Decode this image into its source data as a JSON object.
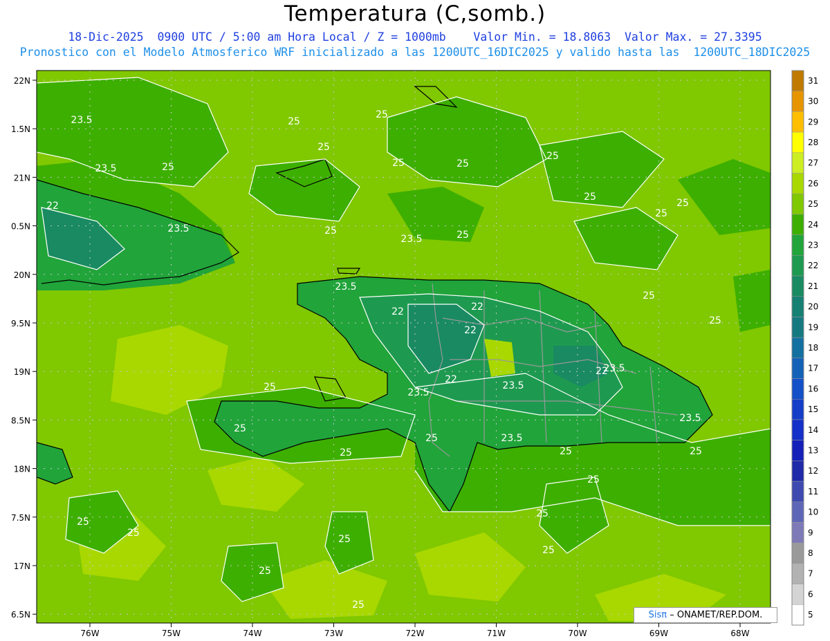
{
  "header": {
    "title": "Temperatura (C,somb.)",
    "line1": "18-Dic-2025  0900 UTC / 5:00 am Hora Local / Z = 1000mb    Valor Min. = 18.8063  Valor Max. = 27.3395",
    "line2": "Pronostico con el Modelo Atmosferico WRF inicializado a las 1200UTC_16DIC2025 y valido hasta las  1200UTC_18DIC2025"
  },
  "axes": {
    "lat_labels": [
      "22N",
      "1.5N",
      "21N",
      "0.5N",
      "20N",
      "9.5N",
      "19N",
      "8.5N",
      "18N",
      "7.5N",
      "17N",
      "6.5N"
    ],
    "lon_labels": [
      "76W",
      "75W",
      "74W",
      "73W",
      "72W",
      "71W",
      "70W",
      "69W",
      "68W"
    ]
  },
  "colorbar": {
    "labels": [
      "31",
      "30",
      "29",
      "28",
      "27",
      "26",
      "25",
      "24",
      "23",
      "22",
      "21",
      "20",
      "19",
      "18",
      "17",
      "16",
      "15",
      "14",
      "13",
      "12",
      "11",
      "10",
      "9",
      "8",
      "7",
      "6",
      "5"
    ],
    "colors": [
      "#c07a00",
      "#e69500",
      "#ffbf00",
      "#ffff00",
      "#ccee22",
      "#a8d800",
      "#80c800",
      "#3daf00",
      "#21a43a",
      "#1e9a50",
      "#198a62",
      "#168073",
      "#157a80",
      "#1470a0",
      "#1462b8",
      "#1450c8",
      "#143ec8",
      "#1430c8",
      "#1420b8",
      "#1e2aa8",
      "#3e4ab0",
      "#5e66b8",
      "#7e7ab8",
      "#9a9a9a",
      "#b2b2b2",
      "#d4d4d4",
      "#ffffff"
    ]
  },
  "contour_labels": [
    "23.5",
    "25",
    "23.5",
    "25",
    "25",
    "25",
    "25",
    "25",
    "25",
    "22",
    "23.5",
    "25",
    "23.5",
    "25",
    "25",
    "25",
    "25",
    "23.5",
    "22",
    "22",
    "22",
    "23.5",
    "22",
    "23.5",
    "22",
    "25",
    "25",
    "23.5",
    "23.5",
    "23.5",
    "25",
    "25",
    "25",
    "25",
    "25",
    "25",
    "25",
    "25",
    "25",
    "25",
    "25",
    "25",
    "25",
    "25"
  ],
  "credit": {
    "brand": "Sisπ",
    "text": "– ONAMET/REP.DOM."
  }
}
